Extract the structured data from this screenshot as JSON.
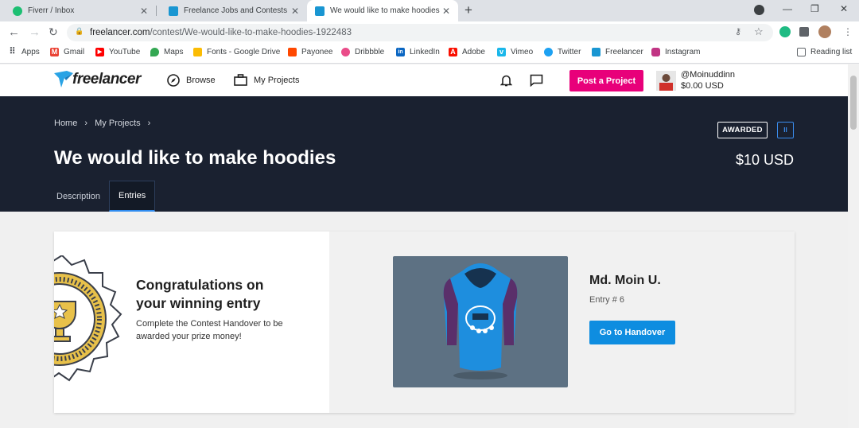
{
  "browser": {
    "tabs": [
      {
        "title": "Fiverr / Inbox",
        "color": "#1dbf73"
      },
      {
        "title": "Freelance Jobs and Contests | Fre",
        "color": "#1996d2"
      },
      {
        "title": "We would like to make hoodies |",
        "color": "#1996d2"
      }
    ],
    "url_prefix": "freelancer.com",
    "url_path": "/contest/We-would-like-to-make-hoodies-1922483",
    "window_controls": [
      "—",
      "❐",
      "✕"
    ]
  },
  "bookmarks": [
    {
      "label": "Apps",
      "color": "#5f6368"
    },
    {
      "label": "Gmail",
      "color": "#ea4335"
    },
    {
      "label": "YouTube",
      "color": "#ff0000"
    },
    {
      "label": "Maps",
      "color": "#34a853"
    },
    {
      "label": "Fonts - Google Drive",
      "color": "#fbbc04"
    },
    {
      "label": "Payonee",
      "color": "#ff4800"
    },
    {
      "label": "Dribbble",
      "color": "#ea4c89"
    },
    {
      "label": "LinkedIn",
      "color": "#0a66c2"
    },
    {
      "label": "Adobe",
      "color": "#fa0f00"
    },
    {
      "label": "Vimeo",
      "color": "#1ab7ea"
    },
    {
      "label": "Twitter",
      "color": "#1da1f2"
    },
    {
      "label": "Freelancer",
      "color": "#1996d2"
    },
    {
      "label": "Instagram",
      "color": "#c13584"
    }
  ],
  "reading_list": "Reading list",
  "header": {
    "logo": "freelancer",
    "browse": "Browse",
    "my_projects": "My Projects",
    "post_project": "Post a Project",
    "username": "@Moinuddinn",
    "balance": "$0.00 USD"
  },
  "banner": {
    "crumb_home": "Home",
    "crumb_projects": "My Projects",
    "sep": "›",
    "title": "We would like to make hoodies",
    "price": "$10 USD",
    "status": "AWARDED",
    "pause": "II",
    "tabs": [
      "Description",
      "Entries"
    ]
  },
  "entry_card": {
    "congrats": "Congratulations on your winning entry",
    "sub": "Complete the Contest Handover to be awarded your prize money!",
    "winner": "Md. Moin U.",
    "entry": "Entry # 6",
    "handover_btn": "Go to Handover"
  }
}
